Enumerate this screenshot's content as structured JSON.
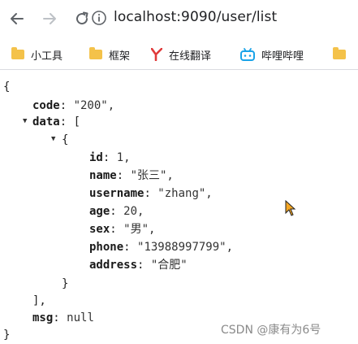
{
  "browser": {
    "url": "localhost:9090/user/list"
  },
  "bookmarks": [
    {
      "label": "小工具",
      "icon": "folder-icon"
    },
    {
      "label": "框架",
      "icon": "folder-icon"
    },
    {
      "label": "在线翻译",
      "icon": "youdao-icon"
    },
    {
      "label": "哔哩哔哩",
      "icon": "bilibili-icon"
    }
  ],
  "json": {
    "open_brace": "{",
    "code_key": "code",
    "code_value": "\"200\",",
    "data_key": "data",
    "data_open": "[",
    "obj_open": "{",
    "id_key": "id",
    "id_value": "1,",
    "name_key": "name",
    "name_value": "\"张三\",",
    "username_key": "username",
    "username_value": "\"zhang\",",
    "age_key": "age",
    "age_value": "20,",
    "sex_key": "sex",
    "sex_value": "\"男\",",
    "phone_key": "phone",
    "phone_value": "\"13988997799\",",
    "address_key": "address",
    "address_value": "\"合肥\"",
    "obj_close": "}",
    "data_close": "],",
    "msg_key": "msg",
    "msg_value": "null",
    "close_brace": "}"
  },
  "watermark": "CSDN @康有为6号"
}
